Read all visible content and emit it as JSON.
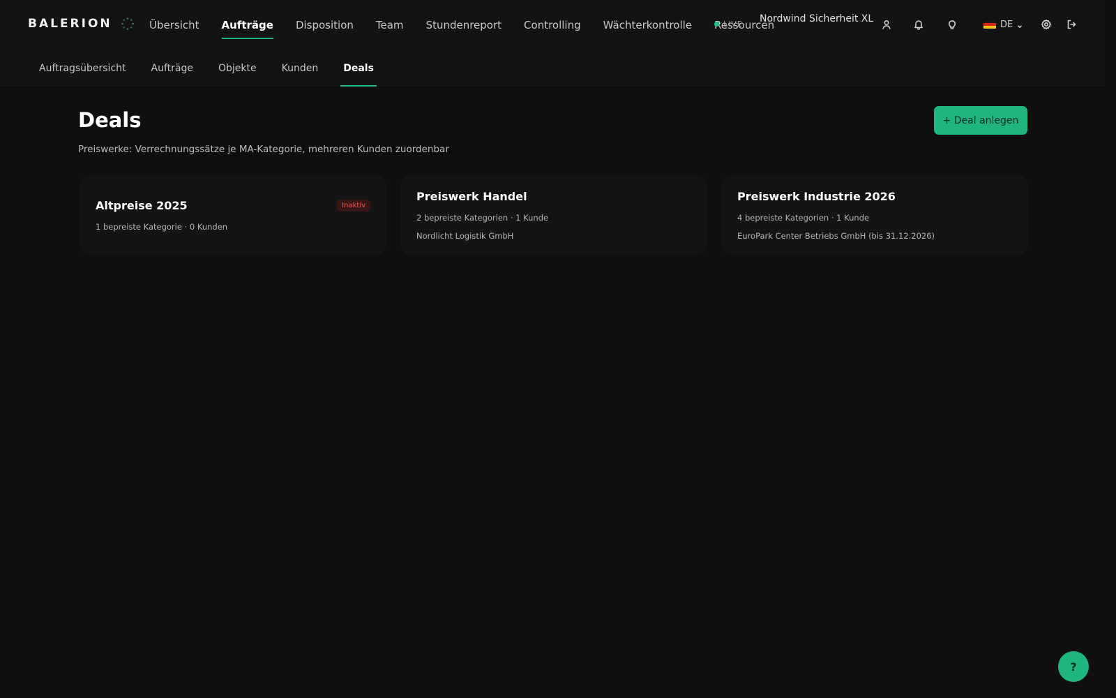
{
  "header": {
    "brand": "BALERION",
    "nav": [
      "Übersicht",
      "Aufträge",
      "Disposition",
      "Team",
      "Stundenreport",
      "Controlling",
      "Wächterkontrolle",
      "Ressourcen"
    ],
    "active_nav": "Aufträge",
    "live_label": "LIVE",
    "company": "Nordwind Sicherheit XL",
    "icons": [
      "user-icon",
      "bell-icon",
      "lightbulb-icon",
      "settings-icon",
      "logout-icon"
    ],
    "language": "DE",
    "flag_icon": "german-flag-icon"
  },
  "subnav": {
    "items": [
      "Auftragsübersicht",
      "Aufträge",
      "Objekte",
      "Kunden",
      "Deals"
    ],
    "active": "Deals"
  },
  "page": {
    "title": "Deals",
    "subtitle": "Preiswerke: Verrechnungssätze je MA-Kategorie, mehreren Kunden zuordenbar",
    "add_button": "+ Deal anlegen"
  },
  "deals": [
    {
      "title": "Altpreise 2025",
      "meta": "1 bepreiste Kategorie · 0 Kunden",
      "client": "",
      "badge": "Inaktiv"
    },
    {
      "title": "Preiswerk Handel",
      "meta": "2 bepreiste Kategorien · 1 Kunde",
      "client": "Nordlicht Logistik GmbH",
      "badge": ""
    },
    {
      "title": "Preiswerk Industrie 2026",
      "meta": "4 bepreiste Kategorien · 1 Kunde",
      "client": "EuroPark Center Betriebs GmbH (bis 31.12.2026)",
      "badge": ""
    }
  ],
  "help_label": "?",
  "colors": {
    "accent": "#1fb57e",
    "background": "#0f0f0f",
    "badge_inactive": "#ef5a5a"
  }
}
